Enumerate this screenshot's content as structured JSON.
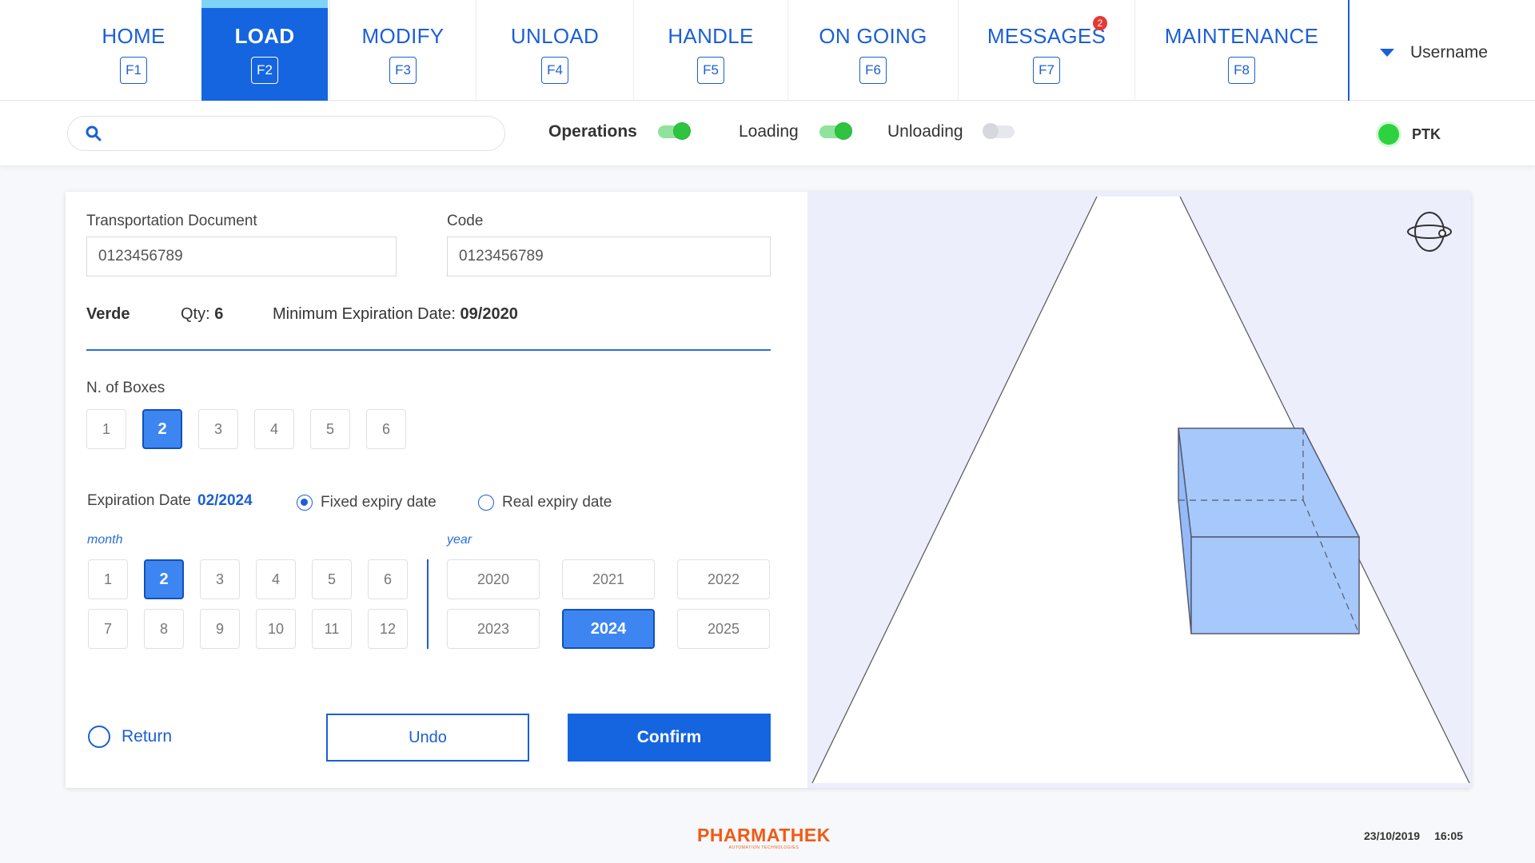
{
  "nav": {
    "items": [
      {
        "label": "HOME",
        "key": "F1"
      },
      {
        "label": "LOAD",
        "key": "F2"
      },
      {
        "label": "MODIFY",
        "key": "F3"
      },
      {
        "label": "UNLOAD",
        "key": "F4"
      },
      {
        "label": "HANDLE",
        "key": "F5"
      },
      {
        "label": "ON GOING",
        "key": "F6"
      },
      {
        "label": "MESSAGES",
        "key": "F7",
        "badge": "2"
      },
      {
        "label": "MAINTENANCE",
        "key": "F8"
      }
    ],
    "active": "LOAD",
    "username": "Username"
  },
  "search": {
    "placeholder": "",
    "value": ""
  },
  "toggles": [
    {
      "label": "Operations",
      "state": "on"
    },
    {
      "label": "Loading",
      "state": "on"
    },
    {
      "label": "Unloading",
      "state": "off"
    }
  ],
  "status": {
    "label": "PTK",
    "color": "#2ed23f"
  },
  "form": {
    "transport_label": "Transportation Document",
    "transport_value": "0123456789",
    "code_label": "Code",
    "code_value": "0123456789",
    "product_name": "Verde",
    "qty_label": "Qty:",
    "qty_value": "6",
    "min_exp_label": "Minimum Expiration Date:",
    "min_exp_value": "09/2020",
    "boxes_label": "N. of Boxes",
    "boxes": [
      "1",
      "2",
      "3",
      "4",
      "5",
      "6"
    ],
    "boxes_selected": "2",
    "exp_label": "Expiration Date",
    "exp_value": "02/2024",
    "radio_fixed": "Fixed expiry date",
    "radio_real": "Real expiry date",
    "radio_selected": "fixed",
    "month_caption": "month",
    "year_caption": "year",
    "months": [
      "1",
      "2",
      "3",
      "4",
      "5",
      "6",
      "7",
      "8",
      "9",
      "10",
      "11",
      "12"
    ],
    "month_selected": "2",
    "years": [
      "2020",
      "2021",
      "2022",
      "2023",
      "2024",
      "2025"
    ],
    "year_selected": "2024"
  },
  "actions": {
    "return_label": "Return",
    "undo_label": "Undo",
    "confirm_label": "Confirm"
  },
  "footer": {
    "brand": "PHARMATHEK",
    "tagline": "AUTOMATION TECHNOLOGIES",
    "date": "23/10/2019",
    "time": "16:05"
  },
  "colors": {
    "primary": "#1565e0",
    "selected": "#3d86f2",
    "status_green": "#2ed23f",
    "brand_orange": "#f05a14",
    "box_fill": "#a6c8fb",
    "viewer_bg": "#eceefc"
  },
  "icons": {
    "search": "search-icon",
    "orbit": "orbit-3d-icon",
    "user_menu": "caret-down-icon"
  }
}
